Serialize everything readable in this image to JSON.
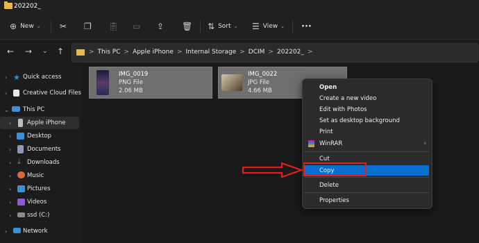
{
  "window": {
    "title": "202202_"
  },
  "toolbar": {
    "new_label": "New",
    "sort_label": "Sort",
    "view_label": "View",
    "more_label": "···"
  },
  "address": {
    "crumbs": [
      "This PC",
      "Apple iPhone",
      "Internal Storage",
      "DCIM",
      "202202_"
    ],
    "separator": ">"
  },
  "sidebar": {
    "items": [
      {
        "label": "Quick access",
        "icon": "star-icon",
        "color": "#3b8fd6"
      },
      {
        "label": "Creative Cloud Files",
        "icon": "creative-cloud-icon",
        "color": "#e8e8e8"
      },
      {
        "label": "This PC",
        "icon": "computer-icon",
        "color": "#3b8fd6"
      },
      {
        "label": "Apple iPhone",
        "icon": "phone-icon",
        "color": "#bdbdbd"
      },
      {
        "label": "Desktop",
        "icon": "desktop-icon",
        "color": "#3b8fd6"
      },
      {
        "label": "Documents",
        "icon": "documents-icon",
        "color": "#8b9bb0"
      },
      {
        "label": "Downloads",
        "icon": "downloads-icon",
        "color": "#3aa86b"
      },
      {
        "label": "Music",
        "icon": "music-icon",
        "color": "#e0663a"
      },
      {
        "label": "Pictures",
        "icon": "pictures-icon",
        "color": "#3b8fd6"
      },
      {
        "label": "Videos",
        "icon": "videos-icon",
        "color": "#8e5bd6"
      },
      {
        "label": "ssd (C:)",
        "icon": "drive-icon",
        "color": "#8b8b8b"
      },
      {
        "label": "Network",
        "icon": "network-icon",
        "color": "#3b8fd6"
      }
    ]
  },
  "files": [
    {
      "name": "IMG_0019",
      "type": "PNG File",
      "size": "2.06 MB"
    },
    {
      "name": "IMG_0022",
      "type": "JPG File",
      "size": "4.66 MB"
    }
  ],
  "context_menu": {
    "items": [
      "Open",
      "Create a new video",
      "Edit with Photos",
      "Set as desktop background",
      "Print",
      "WinRAR",
      "Cut",
      "Copy",
      "Delete",
      "Properties"
    ]
  },
  "colors": {
    "accent": "#0a6ed1",
    "highlight": "#e21e1e"
  }
}
